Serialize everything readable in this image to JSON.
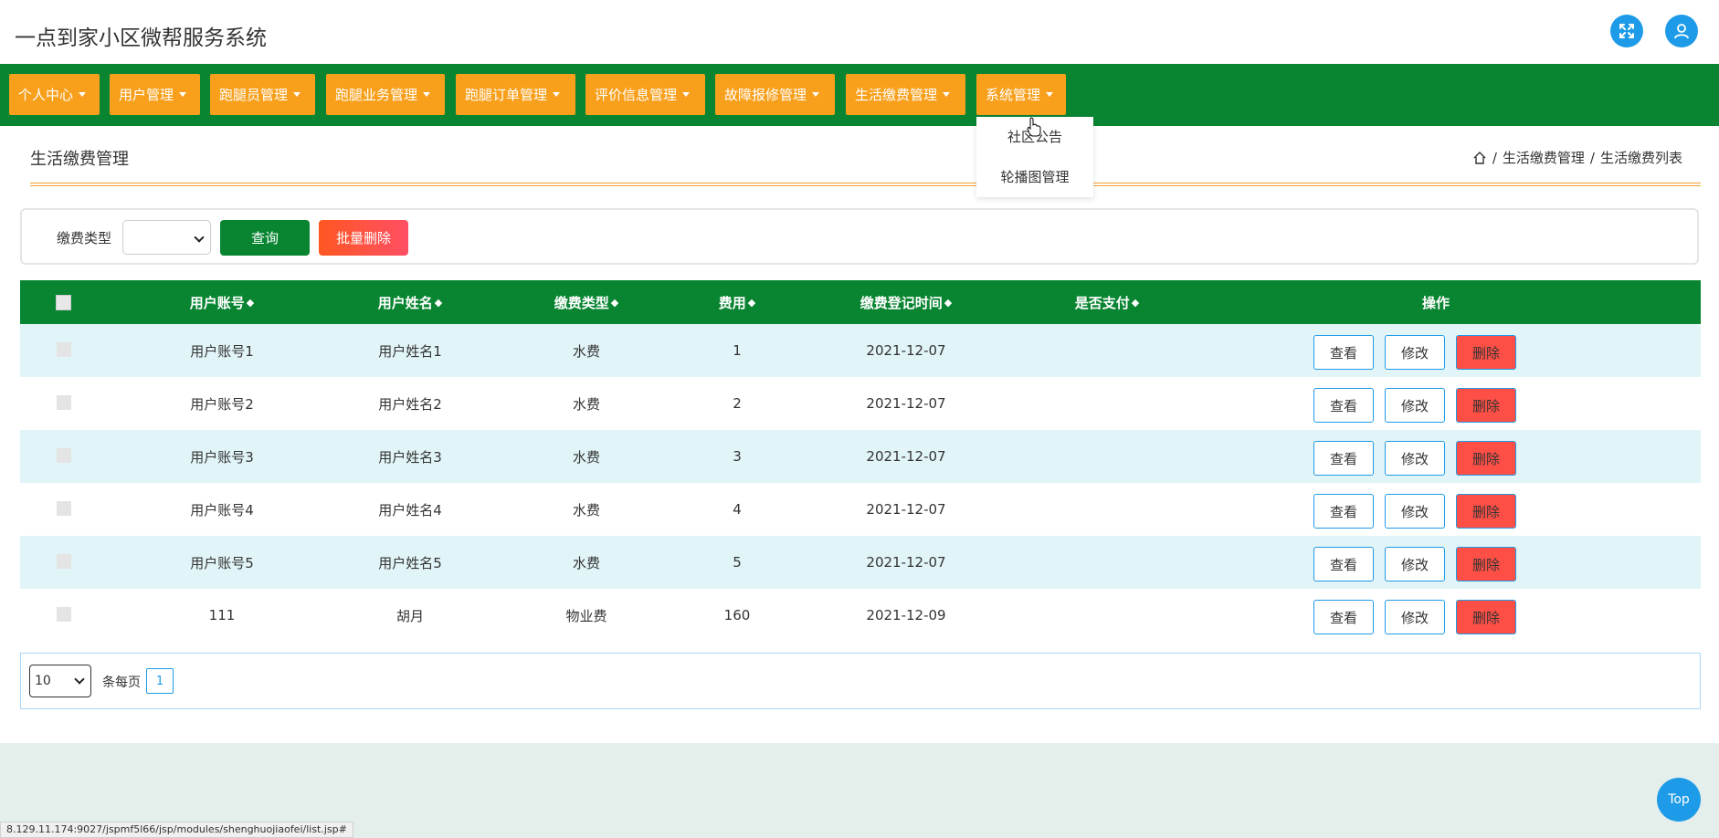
{
  "app": {
    "title": "一点到家小区微帮服务系统"
  },
  "header": {
    "fullscreen_icon": "fullscreen-icon",
    "user_icon": "user-icon",
    "accent": "#1e9be8"
  },
  "nav": {
    "background": "#098532",
    "item_color": "#f8a01c",
    "items": [
      {
        "label": "个人中心"
      },
      {
        "label": "用户管理"
      },
      {
        "label": "跑腿员管理"
      },
      {
        "label": "跑腿业务管理"
      },
      {
        "label": "跑腿订单管理"
      },
      {
        "label": "评价信息管理"
      },
      {
        "label": "故障报修管理"
      },
      {
        "label": "生活缴费管理"
      },
      {
        "label": "系统管理"
      }
    ],
    "dropdown": {
      "items": [
        "社区公告",
        "轮播图管理"
      ]
    }
  },
  "page": {
    "title": "生活缴费管理",
    "breadcrumb": {
      "home_icon": "home-icon",
      "separator": "/",
      "level1": "生活缴费管理",
      "level2": "生活缴费列表"
    }
  },
  "search": {
    "label": "缴费类型",
    "select_value": "",
    "query_button": "查询",
    "batch_delete_button": "批量删除"
  },
  "table": {
    "headers": {
      "account": "用户账号",
      "name": "用户姓名",
      "type": "缴费类型",
      "fee": "费用",
      "time": "缴费登记时间",
      "paid": "是否支付",
      "ops": "操作"
    },
    "sort_icon": "◆",
    "action_labels": {
      "view": "查看",
      "edit": "修改",
      "delete": "删除"
    },
    "rows": [
      {
        "account": "用户账号1",
        "name": "用户姓名1",
        "type": "水费",
        "fee": "1",
        "time": "2021-12-07",
        "paid": ""
      },
      {
        "account": "用户账号2",
        "name": "用户姓名2",
        "type": "水费",
        "fee": "2",
        "time": "2021-12-07",
        "paid": ""
      },
      {
        "account": "用户账号3",
        "name": "用户姓名3",
        "type": "水费",
        "fee": "3",
        "time": "2021-12-07",
        "paid": ""
      },
      {
        "account": "用户账号4",
        "name": "用户姓名4",
        "type": "水费",
        "fee": "4",
        "time": "2021-12-07",
        "paid": ""
      },
      {
        "account": "用户账号5",
        "name": "用户姓名5",
        "type": "水费",
        "fee": "5",
        "time": "2021-12-07",
        "paid": ""
      },
      {
        "account": "111",
        "name": "胡月",
        "type": "物业费",
        "fee": "160",
        "time": "2021-12-09",
        "paid": ""
      }
    ]
  },
  "pagination": {
    "page_size": "10",
    "per_page_label": "条每页",
    "current_page": "1"
  },
  "top_button": "Top",
  "status_url": "8.129.11.174:9027/jspmf5l66/jsp/modules/shenghuojiaofei/list.jsp#"
}
